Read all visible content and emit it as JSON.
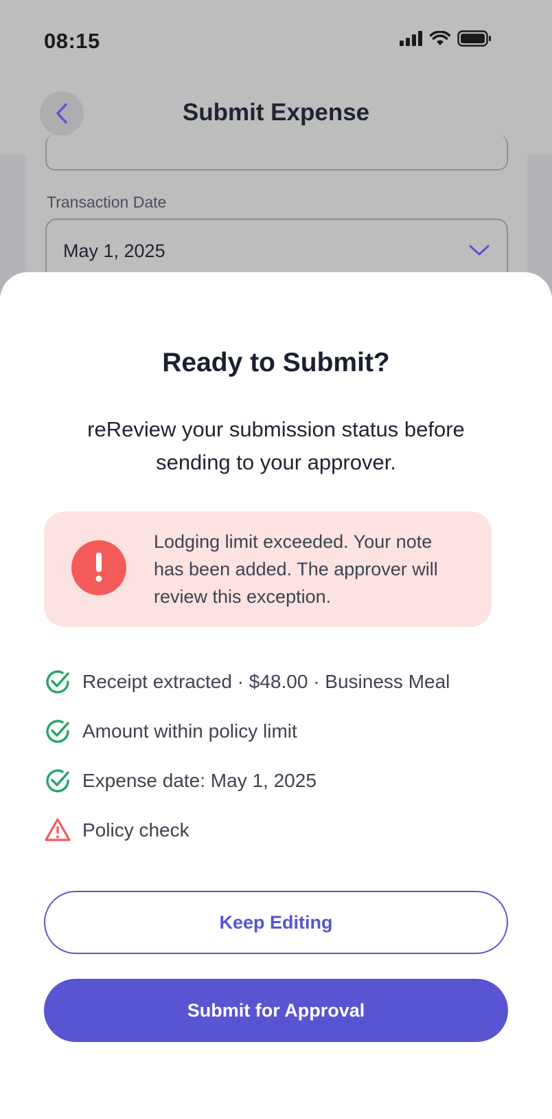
{
  "status_bar": {
    "time": "08:15"
  },
  "header": {
    "title": "Submit Expense"
  },
  "form": {
    "date_label": "Transaction Date",
    "date_value": "May 1, 2025"
  },
  "sheet": {
    "title": "Ready to Submit?",
    "description": "reReview your submission status before sending to your approver.",
    "alert_text": "Lodging limit exceeded. Your note has been added. The approver will review this exception.",
    "checks": [
      {
        "label": "Receipt extracted · $48.00 · Business Meal",
        "status": "ok"
      },
      {
        "label": "Amount within policy limit",
        "status": "ok"
      },
      {
        "label": "Expense date: May 1, 2025",
        "status": "ok"
      },
      {
        "label": "Policy check",
        "status": "warning"
      }
    ],
    "keep_editing_label": "Keep Editing",
    "submit_label": "Submit for Approval"
  },
  "colors": {
    "accent": "#5854d2",
    "success": "#22a565",
    "danger": "#f55a5a",
    "alert_bg": "#fde2e2"
  }
}
